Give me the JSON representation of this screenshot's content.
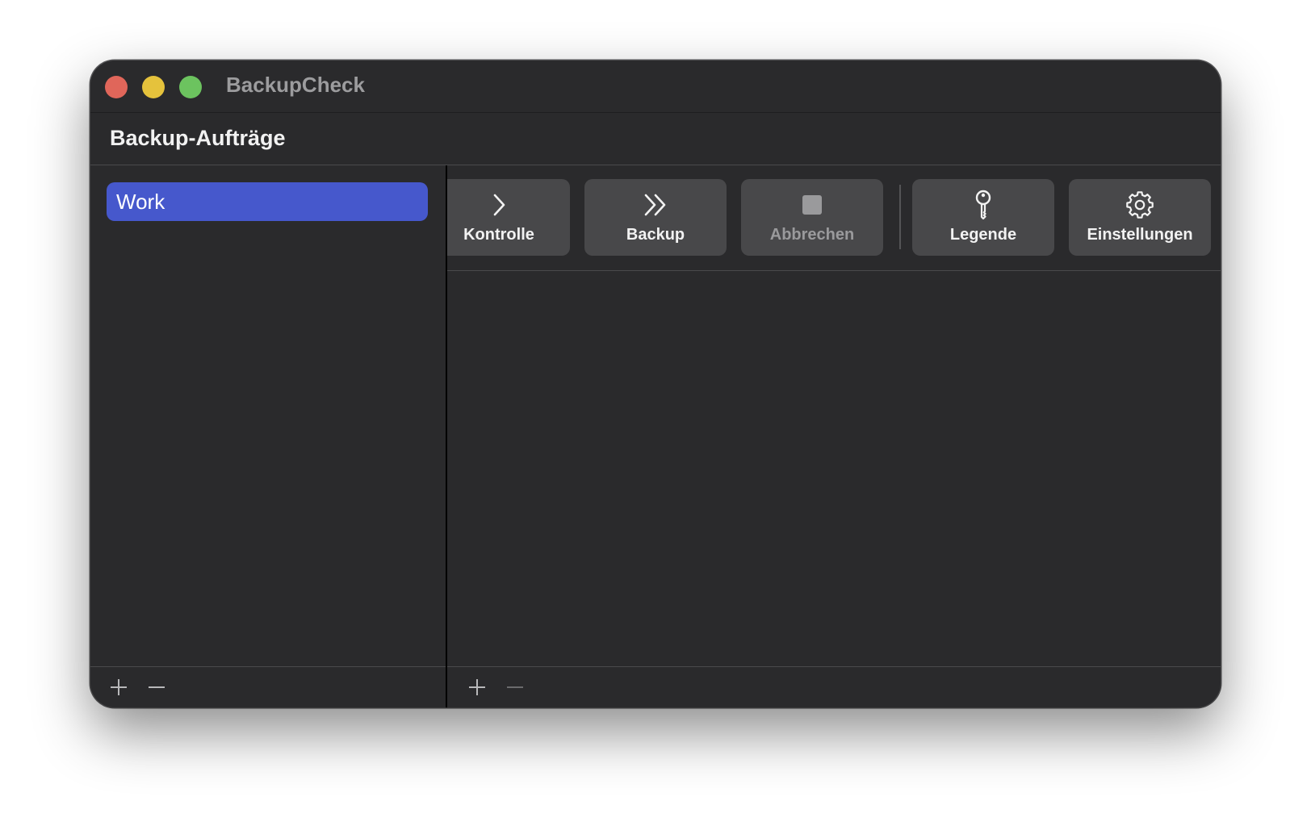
{
  "window": {
    "title": "BackupCheck"
  },
  "section": {
    "title": "Backup-Aufträge"
  },
  "sidebar": {
    "items": [
      {
        "label": "Work",
        "selected": true
      }
    ]
  },
  "toolbar": {
    "buttons": [
      {
        "label": "Kontrolle",
        "icon": "chevron-right-icon",
        "enabled": true
      },
      {
        "label": "Backup",
        "icon": "double-chevron-right-icon",
        "enabled": true
      },
      {
        "label": "Abbrechen",
        "icon": "stop-icon",
        "enabled": false
      },
      {
        "label": "Legende",
        "icon": "key-icon",
        "enabled": true
      },
      {
        "label": "Einstellungen",
        "icon": "gear-icon",
        "enabled": true
      }
    ]
  },
  "footer": {
    "left": {
      "add": "+",
      "remove": "−"
    },
    "right": {
      "add": "+",
      "remove": "−"
    }
  },
  "colors": {
    "window_bg": "#2a2a2c",
    "selection": "#4658cc",
    "button_bg": "#48484a",
    "close": "#e0665a",
    "minimize": "#e5c23c",
    "zoom": "#6cc35f"
  }
}
